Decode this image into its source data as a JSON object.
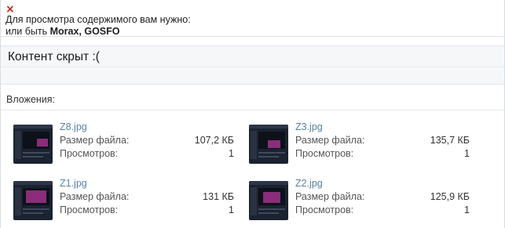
{
  "notice": {
    "close_glyph": "×",
    "line1": "Для просмотра содержимого вам нужно:",
    "line2_prefix": "или быть ",
    "line2_users": "Morax, GOSFO"
  },
  "hidden": {
    "title": "Контент скрыт :("
  },
  "attachments": {
    "heading": "Вложения:",
    "size_label": "Размер файла:",
    "views_label": "Просмотров:",
    "items": [
      {
        "name": "Z8.jpg",
        "size": "107,2 КБ",
        "views": "1"
      },
      {
        "name": "Z3.jpg",
        "size": "135,7 КБ",
        "views": "1"
      },
      {
        "name": "Z1.jpg",
        "size": "131 КБ",
        "views": "1"
      },
      {
        "name": "Z2.jpg",
        "size": "125,9 КБ",
        "views": "1"
      }
    ]
  },
  "colors": {
    "link": "#5a7fa8",
    "close": "#c92020",
    "thumb_accent": "#8a2d7a"
  }
}
